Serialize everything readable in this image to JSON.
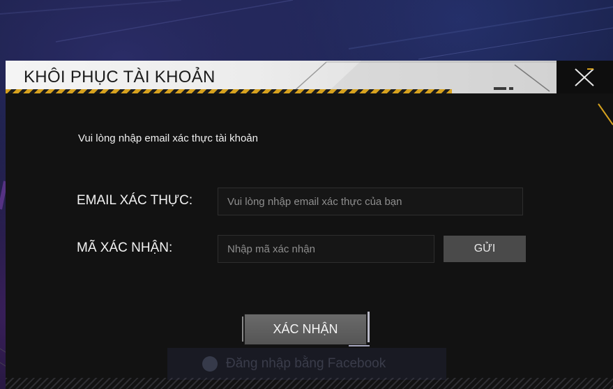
{
  "dialog": {
    "title": "KHÔI PHỤC TÀI KHOẢN",
    "close_icon": "close-icon",
    "instruction": "Vui lòng nhập email xác thực tài khoản",
    "email": {
      "label": "EMAIL XÁC THỰC:",
      "placeholder": "Vui lòng nhập email xác thực của bạn",
      "value": ""
    },
    "code": {
      "label": "MÃ XÁC NHẬN:",
      "placeholder": "Nhập mã xác nhận",
      "value": "",
      "send_label": "GỬI"
    },
    "confirm_label": "XÁC NHẬN"
  },
  "background": {
    "facebook_button_label": "Đăng nhập bằng Facebook",
    "facebook_icon": "facebook-icon"
  },
  "colors": {
    "title_bar": "#f4f4f4",
    "dialog_bg": "#121212",
    "hazard_yellow": "#d7a21f",
    "button_gray": "#4a4a4a",
    "confirm_gray": "#5f5f5f"
  }
}
